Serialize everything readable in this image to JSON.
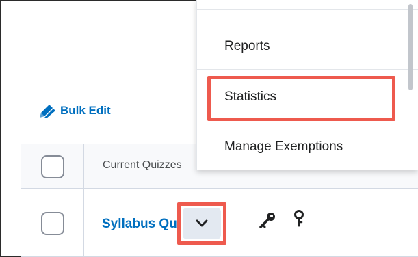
{
  "toolbar": {
    "bulk_edit_label": "Bulk Edit",
    "bulk_edit_icon": "pencil-double-icon"
  },
  "table": {
    "column_header": "Current Quizzes",
    "rows": [
      {
        "title": "Syllabus Quiz",
        "icons": [
          "key-icon",
          "pin-icon"
        ]
      }
    ]
  },
  "context_menu": {
    "items": [
      {
        "label": "Reports"
      },
      {
        "label": "Statistics",
        "highlighted": true
      },
      {
        "label": "Manage Exemptions"
      }
    ]
  },
  "colors": {
    "link": "#006fbf",
    "highlight": "#ee5a4e",
    "header_bg": "#f8f9fb",
    "border": "#d3d9e3"
  }
}
